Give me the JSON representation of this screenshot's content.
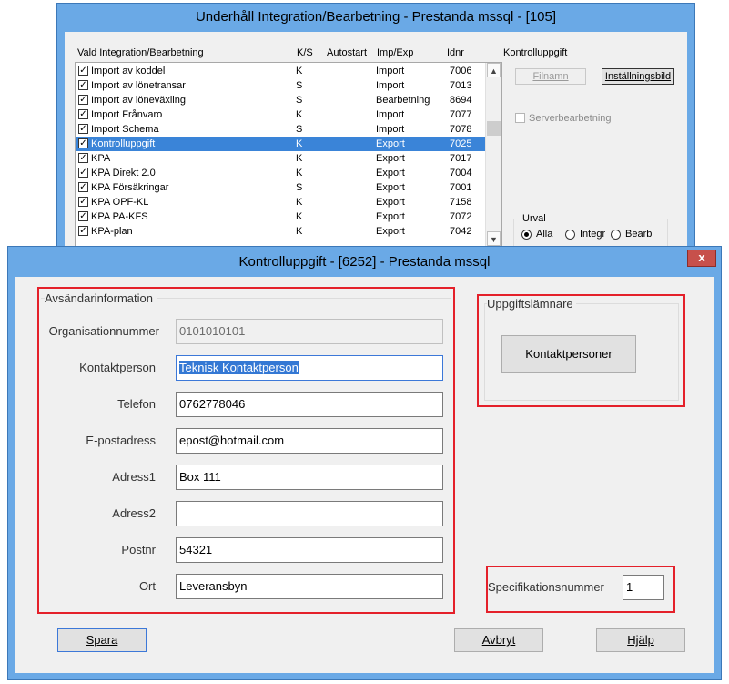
{
  "bg_window": {
    "title": "Underhåll Integration/Bearbetning - Prestanda mssql - [105]",
    "columns": {
      "name": "Vald Integration/Bearbetning",
      "ks": "K/S",
      "autostart": "Autostart",
      "impexp": "Imp/Exp",
      "idnr": "Idnr"
    },
    "rows": [
      {
        "name": "Import av koddel",
        "ks": "K",
        "impexp": "Import",
        "idnr": "7006",
        "checked": true
      },
      {
        "name": "Import av lönetransar",
        "ks": "S",
        "impexp": "Import",
        "idnr": "7013",
        "checked": true
      },
      {
        "name": "Import av löneväxling",
        "ks": "S",
        "impexp": "Bearbetning",
        "idnr": "8694",
        "checked": true
      },
      {
        "name": "Import Frånvaro",
        "ks": "K",
        "impexp": "Import",
        "idnr": "7077",
        "checked": true
      },
      {
        "name": "Import Schema",
        "ks": "S",
        "impexp": "Import",
        "idnr": "7078",
        "checked": true
      },
      {
        "name": "Kontrolluppgift",
        "ks": "K",
        "impexp": "Export",
        "idnr": "7025",
        "checked": true,
        "selected": true
      },
      {
        "name": "KPA",
        "ks": "K",
        "impexp": "Export",
        "idnr": "7017",
        "checked": true
      },
      {
        "name": "KPA Direkt 2.0",
        "ks": "K",
        "impexp": "Export",
        "idnr": "7004",
        "checked": true
      },
      {
        "name": "KPA Försäkringar",
        "ks": "S",
        "impexp": "Export",
        "idnr": "7001",
        "checked": true
      },
      {
        "name": "KPA OPF-KL",
        "ks": "K",
        "impexp": "Export",
        "idnr": "7158",
        "checked": true
      },
      {
        "name": "KPA PA-KFS",
        "ks": "K",
        "impexp": "Export",
        "idnr": "7072",
        "checked": true
      },
      {
        "name": "KPA-plan",
        "ks": "K",
        "impexp": "Export",
        "idnr": "7042",
        "checked": true
      }
    ],
    "side_title": "Kontrolluppgift",
    "filnamn_label": "Filnamn",
    "installning_label": "Inställningsbild",
    "serverbearbetning_label": "Serverbearbetning",
    "urval": {
      "title": "Urval",
      "alla": "Alla",
      "integr": "Integr",
      "bearb": "Bearb"
    }
  },
  "dialog": {
    "title": "Kontrolluppgift - [6252] - Prestanda mssql",
    "close_label": "x",
    "sender_group": "Avsändarinformation",
    "fields": {
      "org_label": "Organisationnummer",
      "org_value": "0101010101",
      "contact_label": "Kontaktperson",
      "contact_value": "Teknisk Kontaktperson",
      "phone_label": "Telefon",
      "phone_value": "0762778046",
      "email_label": "E-postadress",
      "email_value": "epost@hotmail.com",
      "addr1_label": "Adress1",
      "addr1_value": "Box 111",
      "addr2_label": "Adress2",
      "addr2_value": "",
      "zip_label": "Postnr",
      "zip_value": "54321",
      "city_label": "Ort",
      "city_value": "Leveransbyn"
    },
    "filer_group": "Uppgiftslämnare",
    "contacts_button": "Kontaktpersoner",
    "spec_label": "Specifikationsnummer",
    "spec_value": "1",
    "save_label": "Spara",
    "cancel_label": "Avbryt",
    "help_label": "Hjälp",
    "colors": {
      "highlight": "#e4202a",
      "selection": "#3a84d8",
      "titlebar": "#6aa9e6"
    }
  }
}
